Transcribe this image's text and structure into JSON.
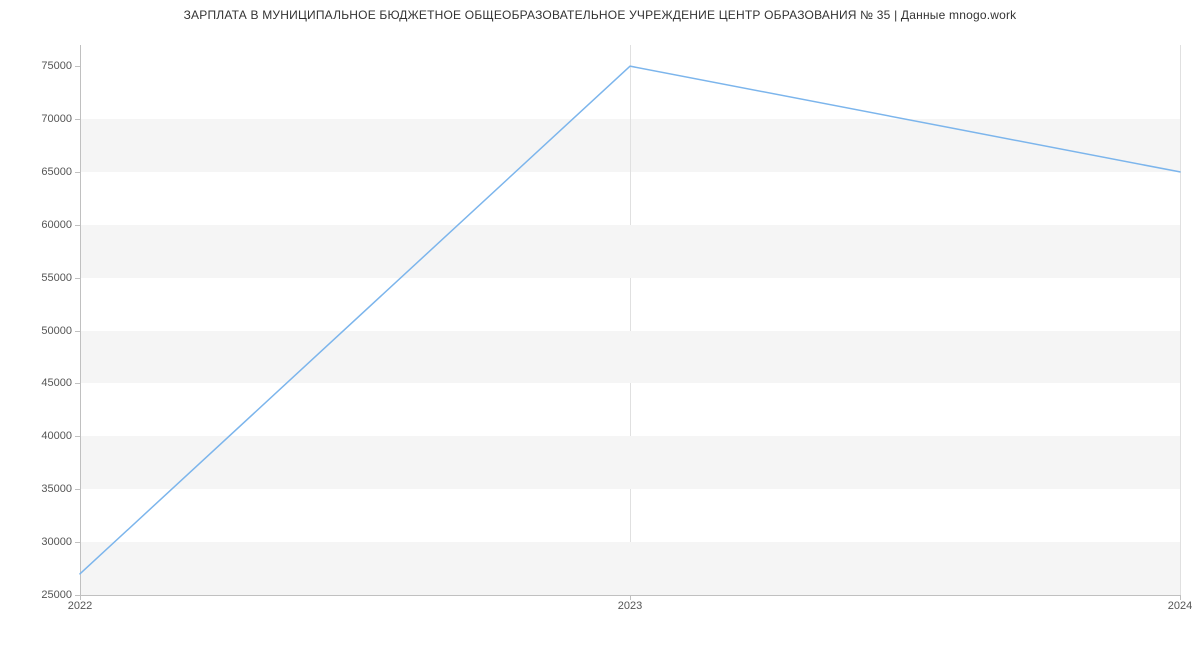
{
  "chart_data": {
    "type": "line",
    "title": "ЗАРПЛАТА В МУНИЦИПАЛЬНОЕ БЮДЖЕТНОЕ ОБЩЕОБРАЗОВАТЕЛЬНОЕ УЧРЕЖДЕНИЕ ЦЕНТР ОБРАЗОВАНИЯ № 35 | Данные mnogo.work",
    "xlabel": "",
    "ylabel": "",
    "x_ticks": [
      "2022",
      "2023",
      "2024"
    ],
    "y_ticks": [
      25000,
      30000,
      35000,
      40000,
      45000,
      50000,
      55000,
      60000,
      65000,
      70000,
      75000
    ],
    "ylim": [
      25000,
      77000
    ],
    "x": [
      2022,
      2023,
      2024
    ],
    "values": [
      27000,
      75000,
      65000
    ],
    "series_color": "#7cb5ec"
  }
}
